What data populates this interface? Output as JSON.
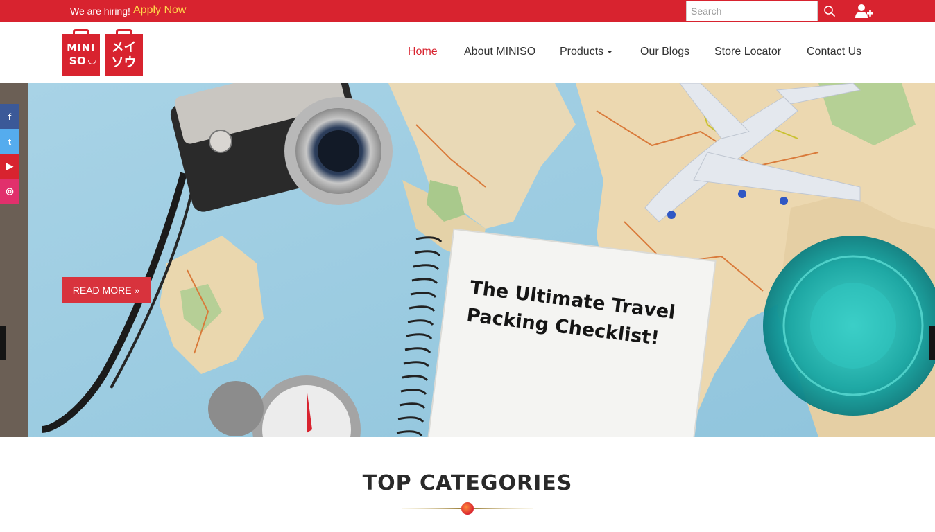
{
  "topbar": {
    "hiring_text": "We are hiring!",
    "apply_label": "Apply Now",
    "search_placeholder": "Search",
    "search_icon": "search-icon",
    "user_icon": "add-user-icon"
  },
  "logo": {
    "left_line1": "MINI",
    "left_line2": "SO",
    "left_smile": "◡",
    "right_line1": "メイ",
    "right_line2": "ソウ"
  },
  "nav": {
    "items": [
      {
        "label": "Home",
        "active": true
      },
      {
        "label": "About MINISO"
      },
      {
        "label": "Products",
        "dropdown": true
      },
      {
        "label": "Our Blogs"
      },
      {
        "label": "Store Locator"
      },
      {
        "label": "Contact Us"
      }
    ]
  },
  "hero": {
    "button_label": "READ MORE »",
    "headline_line1": "The Ultimate Travel",
    "headline_line2": "Packing Checklist!"
  },
  "social": [
    {
      "name": "facebook-icon",
      "glyph": "f"
    },
    {
      "name": "twitter-icon",
      "glyph": "t"
    },
    {
      "name": "youtube-icon",
      "glyph": "▶"
    },
    {
      "name": "instagram-icon",
      "glyph": "◎"
    }
  ],
  "categories": {
    "title": "TOP CATEGORIES"
  },
  "colors": {
    "brand_red": "#d8232f",
    "apply_yellow": "#ffd84a"
  }
}
